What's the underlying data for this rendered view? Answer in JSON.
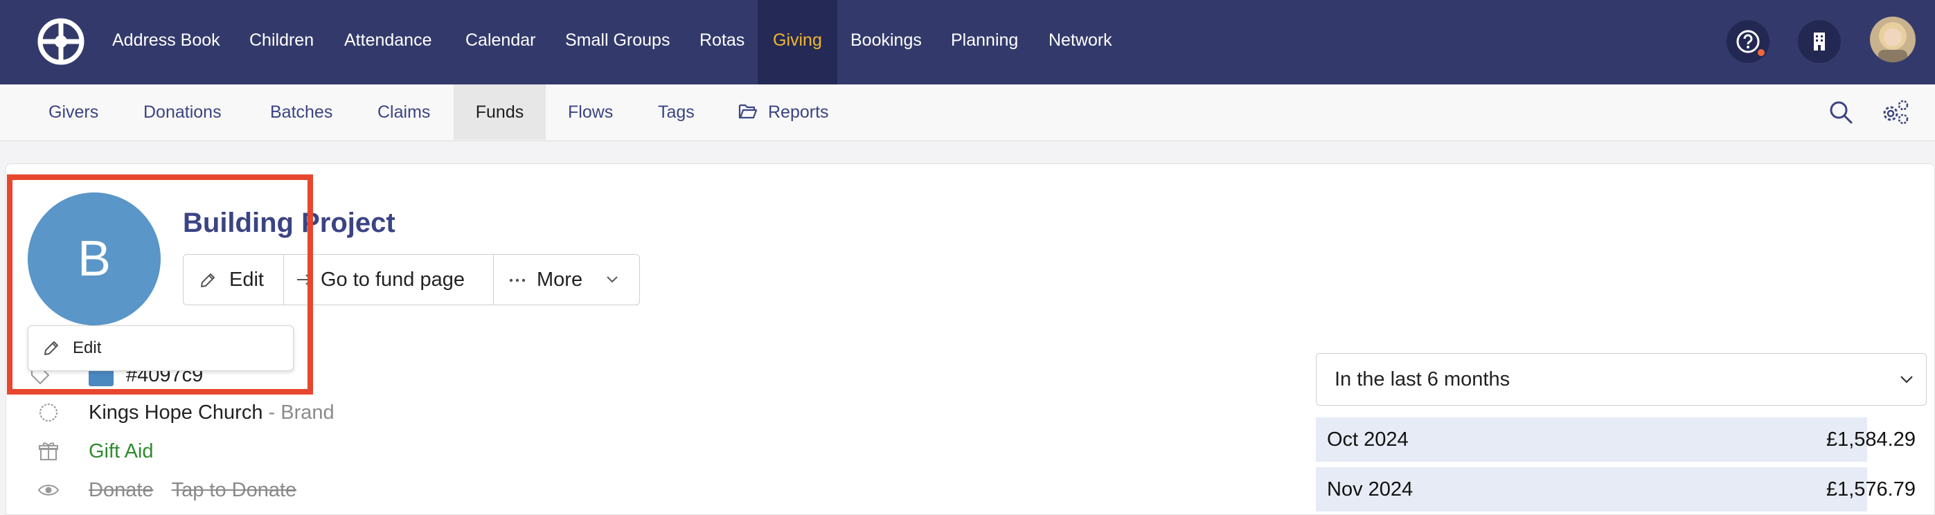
{
  "topnav": {
    "items": [
      "Address Book",
      "Children",
      "Attendance",
      "Calendar",
      "Small Groups",
      "Rotas",
      "Giving",
      "Bookings",
      "Planning",
      "Network"
    ],
    "active": "Giving"
  },
  "subnav": {
    "items": [
      "Givers",
      "Donations",
      "Batches",
      "Claims",
      "Funds",
      "Flows",
      "Tags",
      "Reports"
    ],
    "active": "Funds"
  },
  "fund": {
    "initial": "B",
    "title": "Building Project",
    "edit_label": "Edit",
    "go_label": "Go to fund page",
    "more_label": "More",
    "popup_edit_label": "Edit",
    "partial_text": "#4097c9",
    "color": "#4097c9",
    "organisation": "Kings Hope Church",
    "org_suffix": " - Brand",
    "gift_aid": "Gift Aid",
    "visibility_1": "Donate",
    "visibility_2": "Tap to Donate"
  },
  "stats": {
    "period": "In the last 6 months",
    "rows": [
      {
        "month": "Oct 2024",
        "amount": "£1,584.29"
      },
      {
        "month": "Nov 2024",
        "amount": "£1,576.79"
      }
    ]
  },
  "colors": {
    "nav_bg": "#333a6b",
    "accent": "#f2b531",
    "link": "#3b4483",
    "gift_aid": "#2e8b2e",
    "highlight": "#e6472e"
  }
}
